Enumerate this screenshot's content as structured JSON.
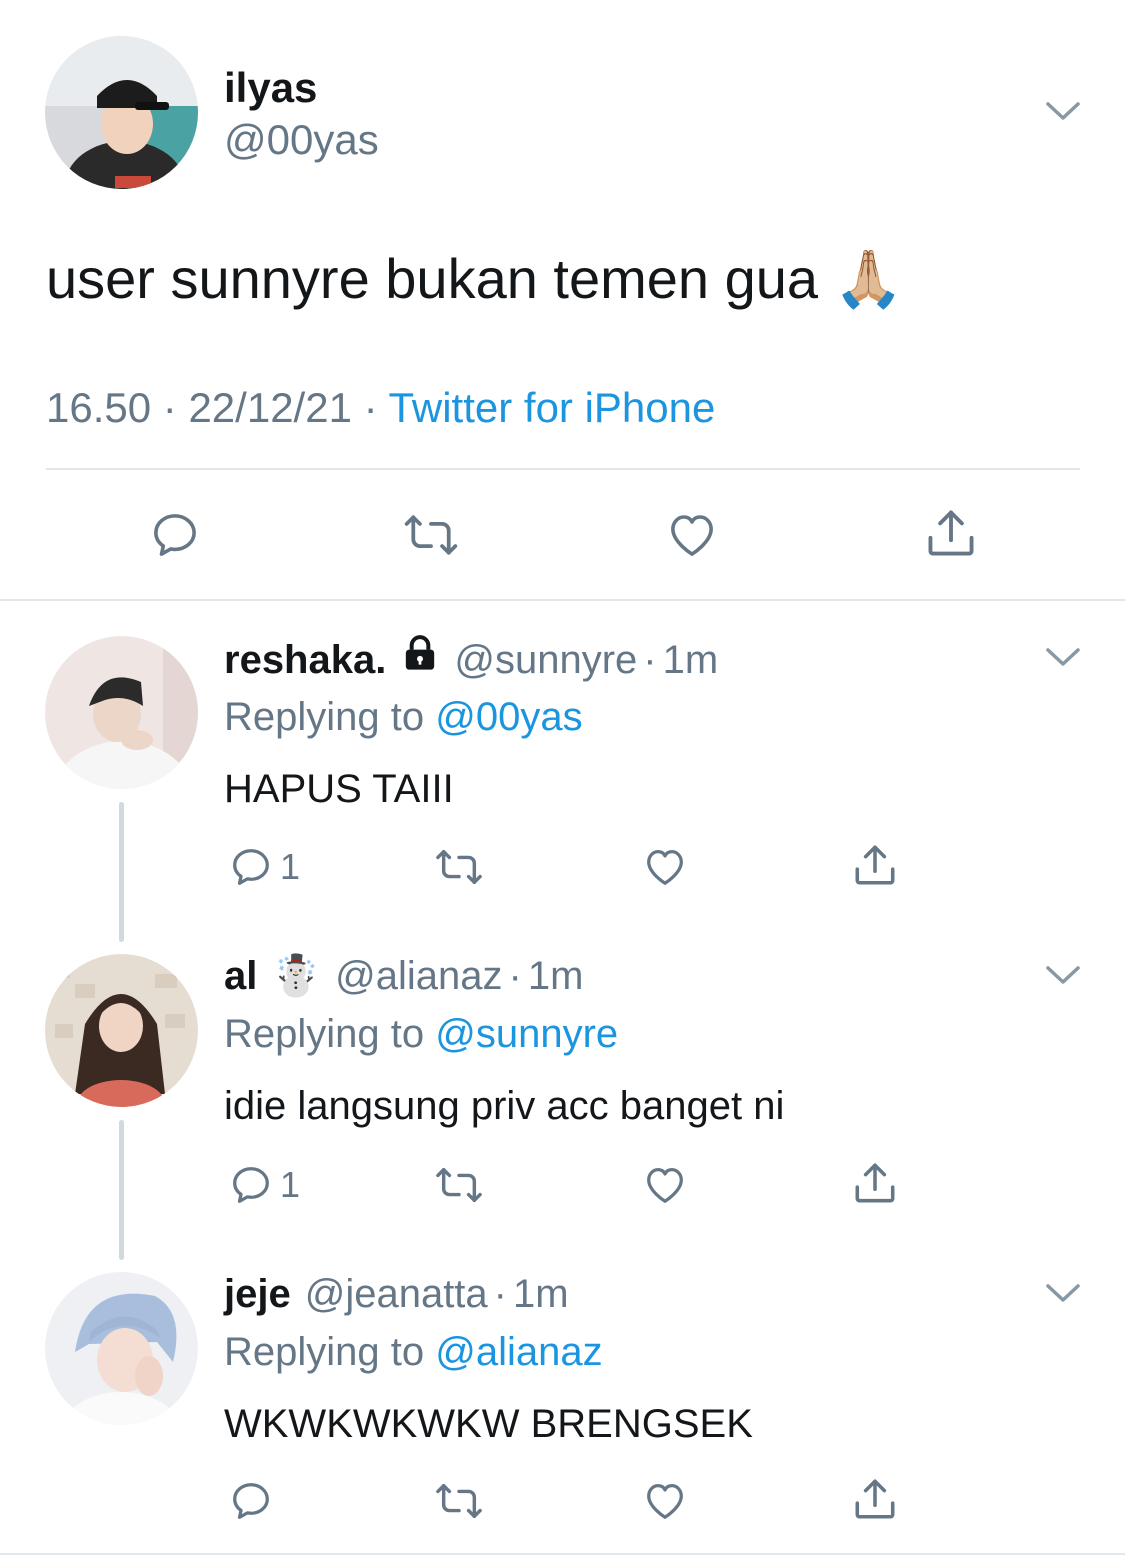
{
  "main_tweet": {
    "display_name": "ilyas",
    "handle": "@00yas",
    "text": "user sunnyre bukan temen gua",
    "emoji": "🙏🏼",
    "time": "16.50",
    "date": "22/12/21",
    "separator": "·",
    "source": "Twitter for iPhone"
  },
  "replies": [
    {
      "display_name": "reshaka.",
      "handle": "@sunnyre",
      "age": "1m",
      "separator": "·",
      "replying_label": "Replying to",
      "replying_to": "@00yas",
      "text": "HAPUS TAIII",
      "reply_count": "1",
      "locked": true
    },
    {
      "display_name": "al",
      "name_emoji": "☃️",
      "handle": "@alianaz",
      "age": "1m",
      "separator": "·",
      "replying_label": "Replying to",
      "replying_to": "@sunnyre",
      "text": "idie langsung priv acc banget ni",
      "reply_count": "1"
    },
    {
      "display_name": "jeje",
      "handle": "@jeanatta",
      "age": "1m",
      "separator": "·",
      "replying_label": "Replying to",
      "replying_to": "@alianaz",
      "text": "WKWKWKWKW BRENGSEK",
      "reply_count": ""
    }
  ],
  "colors": {
    "link_blue": "#1b95e0",
    "secondary_gray": "#657786",
    "divider": "#e1e8ed",
    "thread_line": "#cfd9de"
  },
  "icons": [
    "chevron-down-icon",
    "reply-icon",
    "retweet-icon",
    "like-icon",
    "share-icon",
    "lock-icon"
  ]
}
